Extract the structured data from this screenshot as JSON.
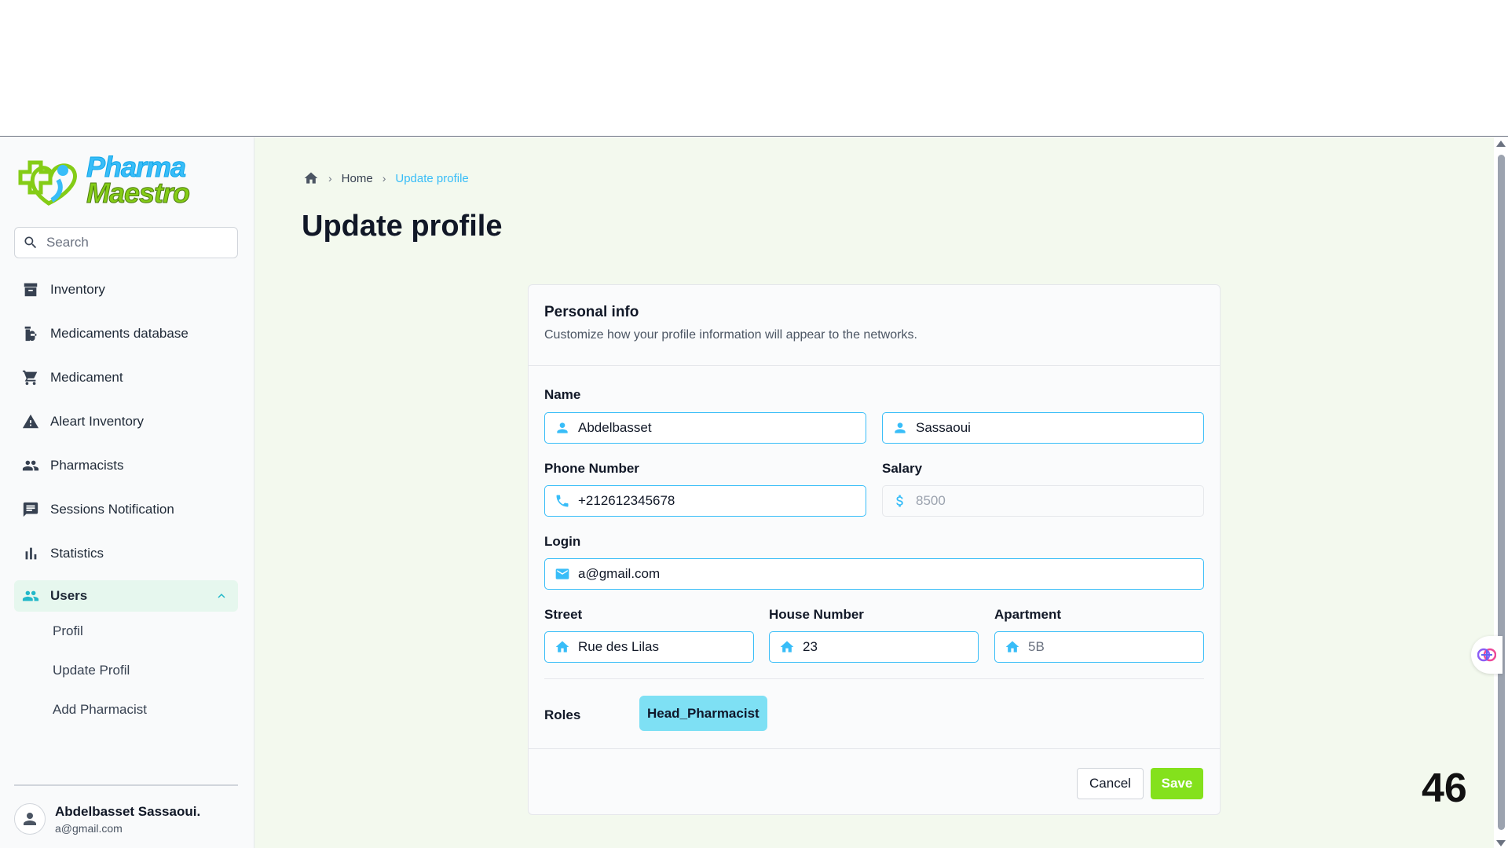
{
  "brand": {
    "line1": "Pharma",
    "line2": "Maestro"
  },
  "search": {
    "placeholder": "Search"
  },
  "sidebar": {
    "items": [
      {
        "label": "Inventory",
        "icon": "archive-icon"
      },
      {
        "label": "Medicaments database",
        "icon": "pills-icon"
      },
      {
        "label": "Medicament",
        "icon": "cart-icon"
      },
      {
        "label": "Aleart Inventory",
        "icon": "warning-icon"
      },
      {
        "label": "Pharmacists",
        "icon": "people-icon"
      },
      {
        "label": "Sessions Notification",
        "icon": "message-icon"
      },
      {
        "label": "Statistics",
        "icon": "bar-chart-icon"
      }
    ],
    "active": {
      "label": "Users",
      "icon": "users-icon"
    },
    "subitems": [
      "Profil",
      "Update Profil",
      "Add Pharmacist"
    ]
  },
  "user": {
    "name": "Abdelbasset Sassaoui.",
    "email": "a@gmail.com"
  },
  "breadcrumb": {
    "home": "Home",
    "current": "Update profile"
  },
  "page": {
    "title": "Update profile"
  },
  "card": {
    "title": "Personal info",
    "subtitle": "Customize how your profile information will appear to the networks.",
    "labels": {
      "name": "Name",
      "phone": "Phone Number",
      "salary": "Salary",
      "login": "Login",
      "street": "Street",
      "house": "House Number",
      "apartment": "Apartment",
      "roles": "Roles"
    },
    "values": {
      "first_name": "Abdelbasset",
      "last_name": "Sassaoui",
      "phone": "+212612345678",
      "salary": "8500",
      "login": "a@gmail.com",
      "street": "Rue des Lilas",
      "house": "23",
      "apartment_placeholder": "5B"
    },
    "role": "Head_Pharmacist",
    "cancel": "Cancel",
    "save": "Save"
  },
  "colors": {
    "accent": "#38bdf8",
    "save": "#84e11c",
    "role_chip": "#7ee0f4",
    "main_bg": "#f3f9ee"
  },
  "page_number": "46"
}
